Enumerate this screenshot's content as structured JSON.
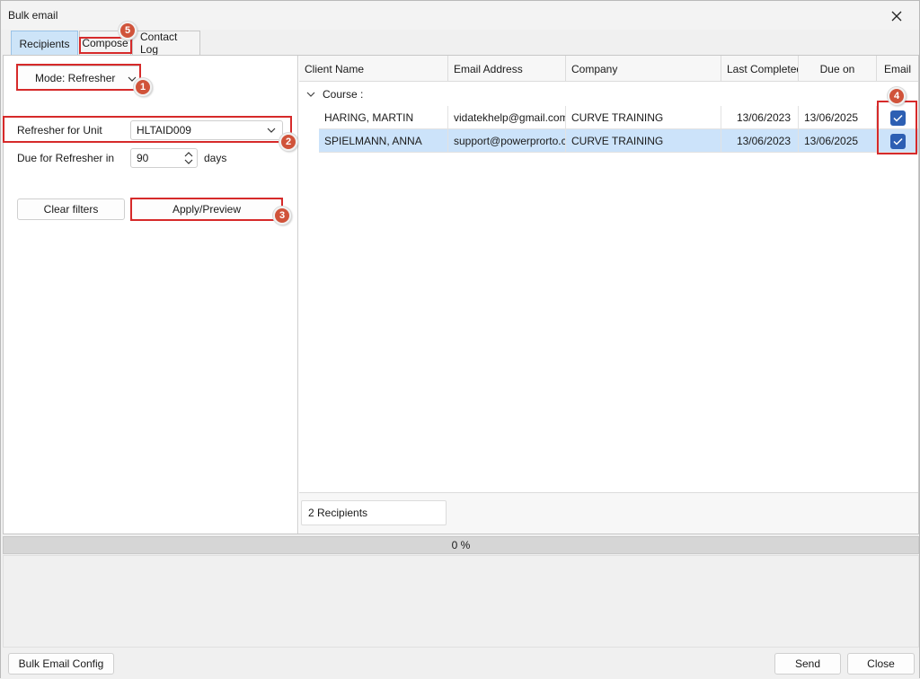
{
  "window": {
    "title": "Bulk email"
  },
  "tabs": [
    {
      "label": "Recipients",
      "active": true
    },
    {
      "label": "Compose",
      "active": false
    },
    {
      "label": "Contact Log",
      "active": false
    }
  ],
  "filters": {
    "mode_button_label": "Mode: Refresher",
    "refresher_unit_label": "Refresher for Unit",
    "refresher_unit_value": "HLTAID009",
    "due_label": "Due for Refresher in",
    "due_value": "90",
    "due_unit": "days",
    "clear_button": "Clear filters",
    "apply_button": "Apply/Preview"
  },
  "grid": {
    "columns": [
      "Client Name",
      "Email Address",
      "Company",
      "Last Completed",
      "Due on",
      "Email"
    ],
    "group_label": "Course :",
    "rows": [
      {
        "client": "HARING, MARTIN",
        "email": "vidatekhelp@gmail.com",
        "company": "CURVE TRAINING",
        "last_completed": "13/06/2023",
        "due_on": "13/06/2025",
        "email_checked": true,
        "selected": false
      },
      {
        "client": "SPIELMANN, ANNA",
        "email": "support@powerprorto.com",
        "company": "CURVE TRAINING",
        "last_completed": "13/06/2023",
        "due_on": "13/06/2025",
        "email_checked": true,
        "selected": true
      }
    ],
    "recipient_count": "2 Recipients"
  },
  "progress": {
    "text": "0 %",
    "value_percent": 0
  },
  "bottom": {
    "config_button": "Bulk Email Config",
    "send_button": "Send",
    "close_button": "Close"
  },
  "annotations": [
    "1",
    "2",
    "3",
    "4",
    "5"
  ],
  "colors": {
    "accent": "#2d5fb3",
    "selected_row": "#cce3fa",
    "highlight_box": "#d62a2a",
    "badge": "#d0533a"
  }
}
